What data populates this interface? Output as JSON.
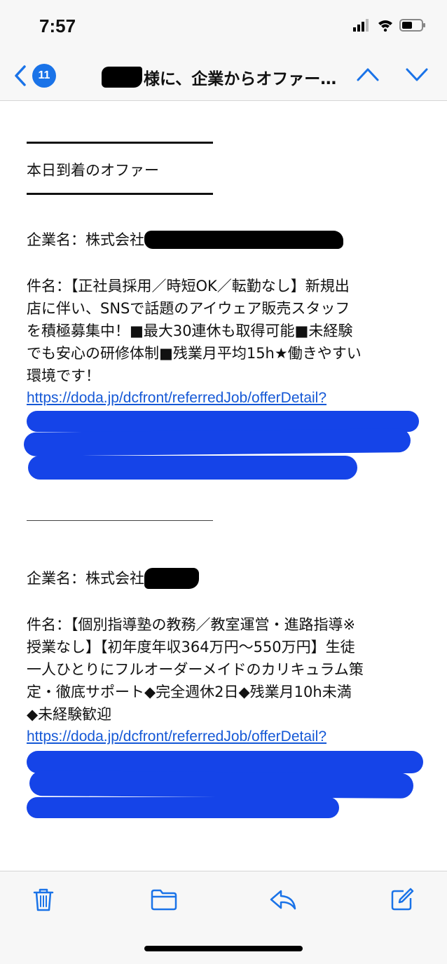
{
  "status": {
    "time": "7:57"
  },
  "nav": {
    "back_badge": "11",
    "title": "様に、企業からオファー…"
  },
  "mail": {
    "section_header": "本日到着のオファー",
    "offers": [
      {
        "company_label": "企業名：株式会社",
        "subject_lines": [
          "件名：【正社員採用／時短OK／転勤なし】新規出",
          "店に伴い、SNSで話題のアイウェア販売スタッフ",
          "を積極募集中！■最大30連休も取得可能■未経験",
          "でも安心の研修体制■残業月平均15h★働きやすい",
          "環境です！"
        ],
        "link": "https://doda.jp/dcfront/referredJob/offerDetail?"
      },
      {
        "company_label": "企業名：株式会社",
        "subject_lines": [
          "件名：【個別指導塾の教務／教室運営・進路指導※",
          "授業なし】【初年度年収364万円〜550万円】生徒",
          "一人ひとりにフルオーダーメイドのカリキュラム策",
          "定・徹底サポート◆完全週休2日◆残業月10h未満",
          "◆未経験歓迎"
        ],
        "link": "https://doda.jp/dcfront/referredJob/offerDetail?"
      }
    ]
  },
  "icons": {
    "toolbar": [
      "trash-icon",
      "folder-icon",
      "reply-icon",
      "compose-icon"
    ],
    "nav": [
      "chevron-left-icon",
      "chevron-up-icon",
      "chevron-down-icon"
    ]
  },
  "colors": {
    "accent": "#1a73e8",
    "link": "#1558d6",
    "redaction_blue": "#1544e8"
  }
}
